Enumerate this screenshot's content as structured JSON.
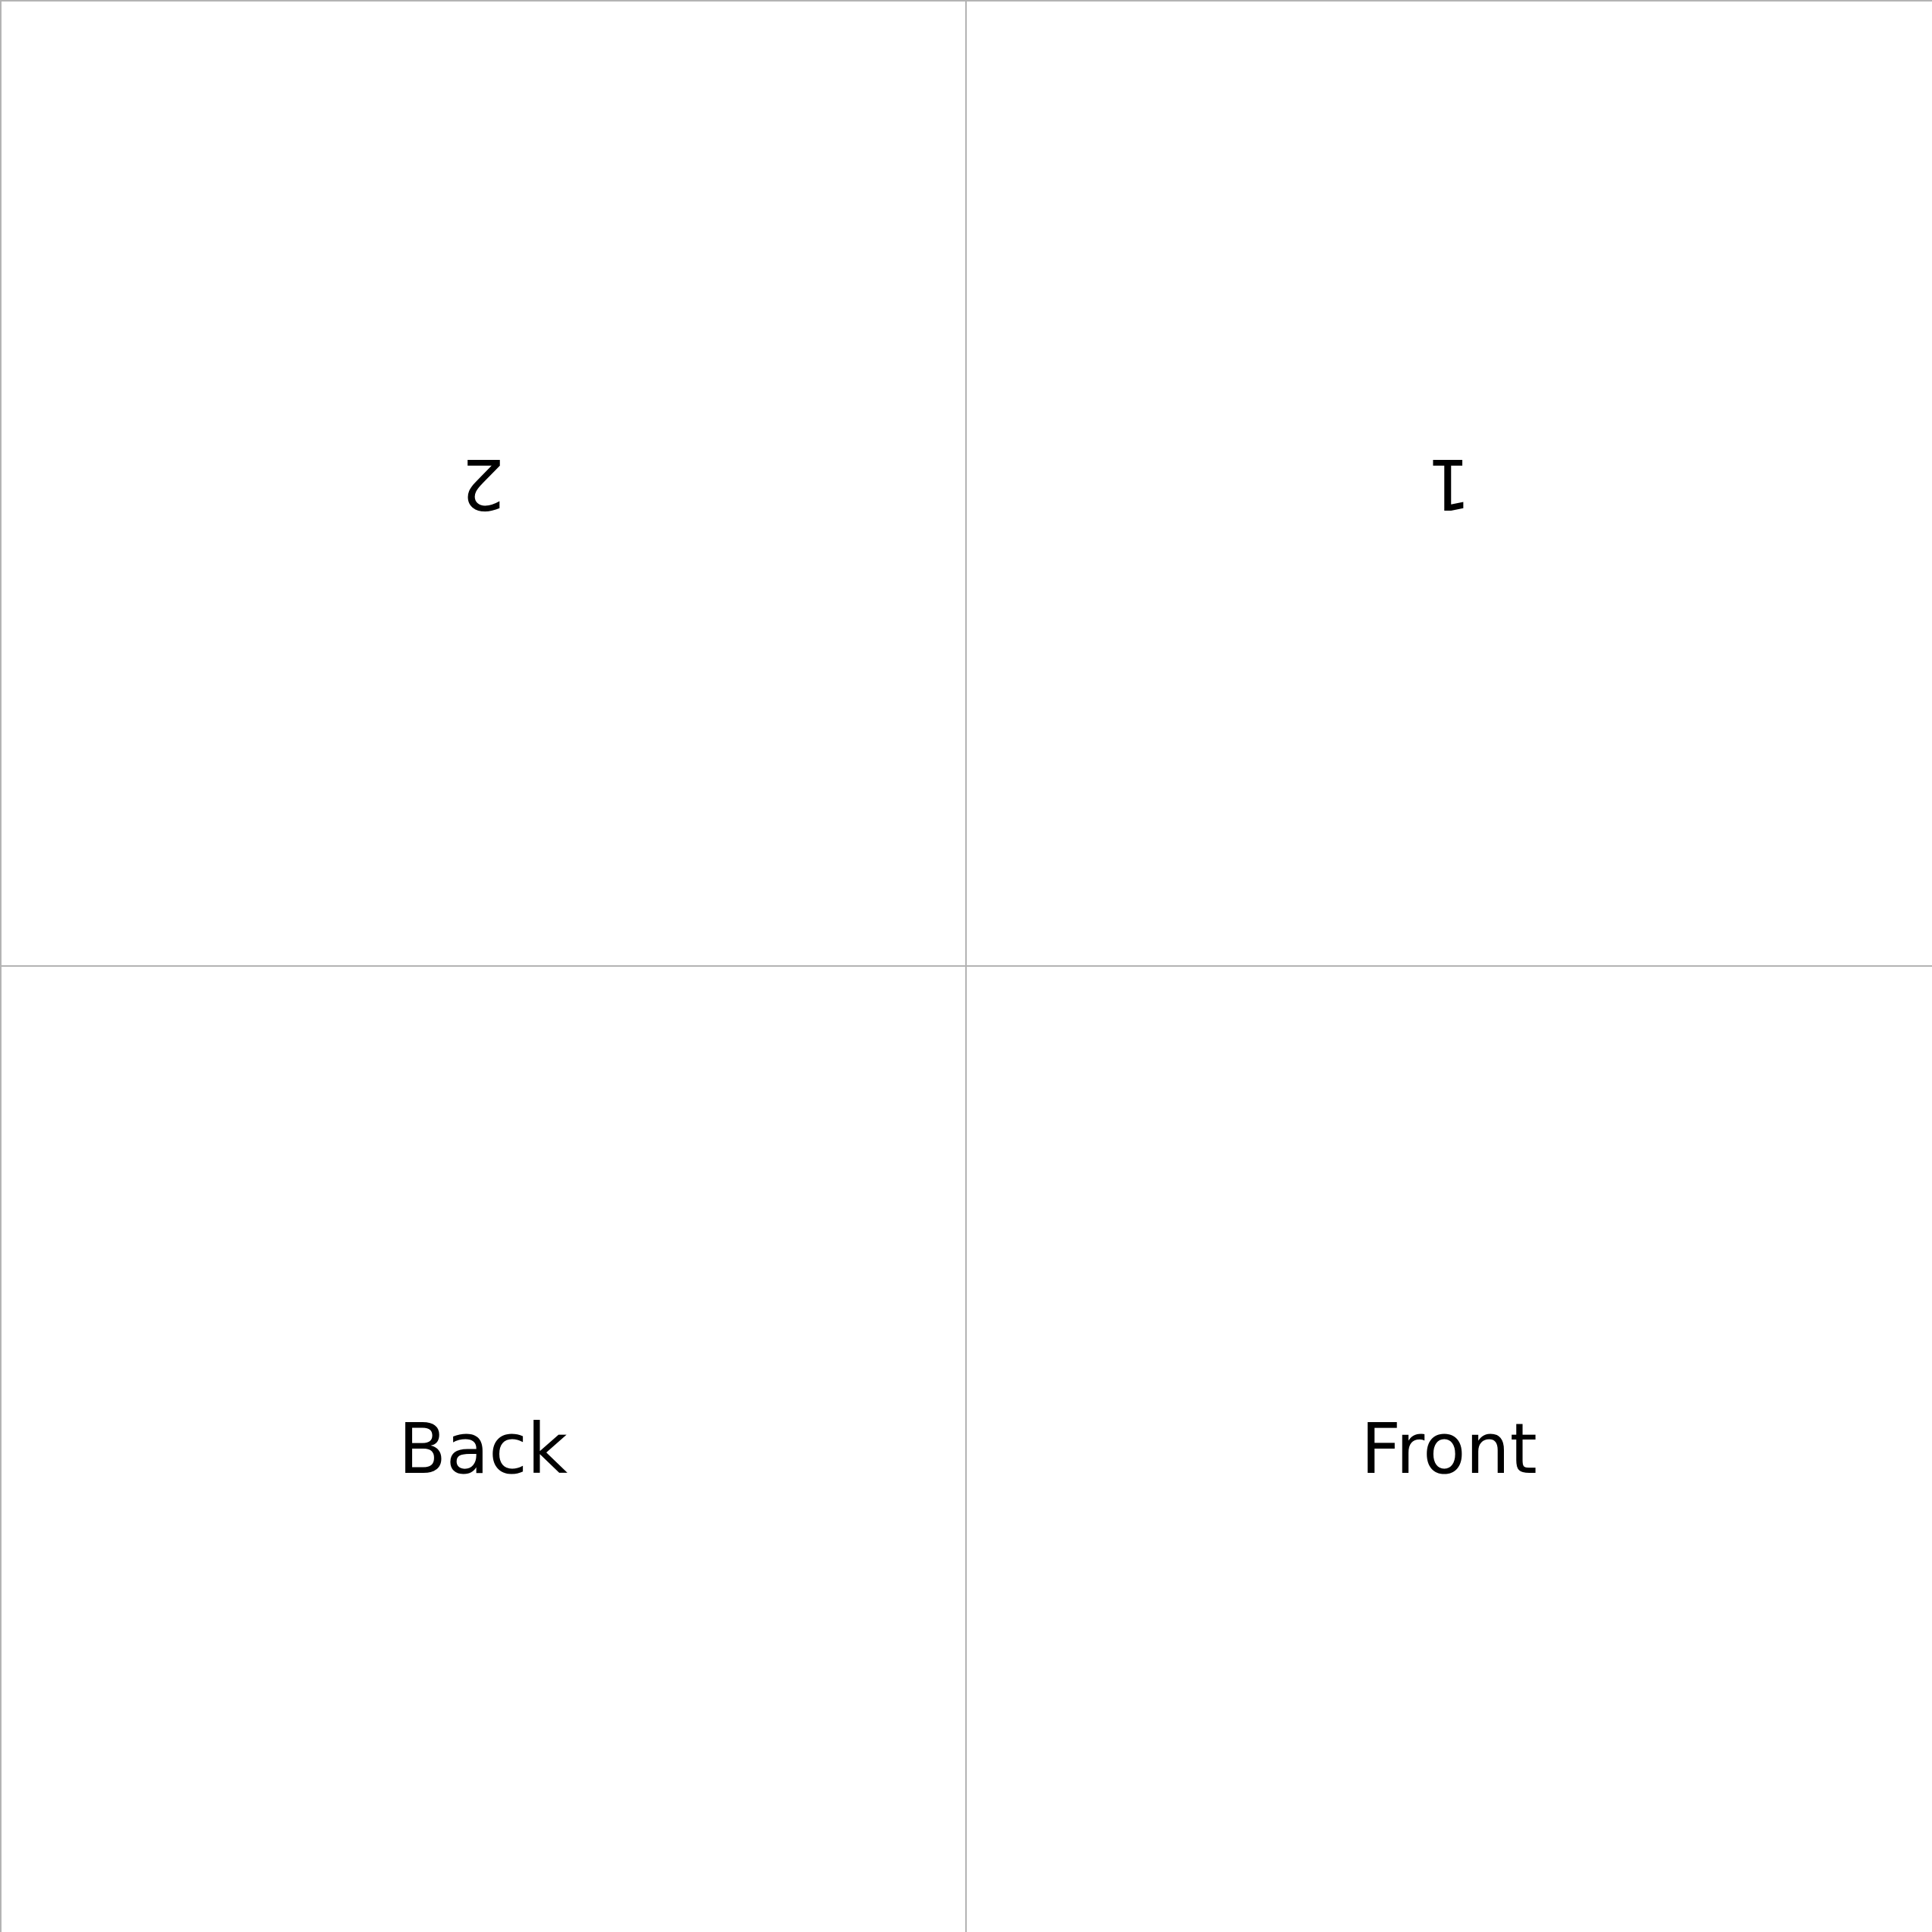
{
  "panels": {
    "top_left": {
      "label": "2",
      "orientation": "upside-down"
    },
    "top_right": {
      "label": "1",
      "orientation": "upside-down"
    },
    "bottom_left": {
      "label": "Back",
      "orientation": "upright"
    },
    "bottom_right": {
      "label": "Front",
      "orientation": "upright"
    }
  },
  "colors": {
    "background": "#ffffff",
    "fold_line": "#b3b3b3",
    "text": "#000000"
  }
}
